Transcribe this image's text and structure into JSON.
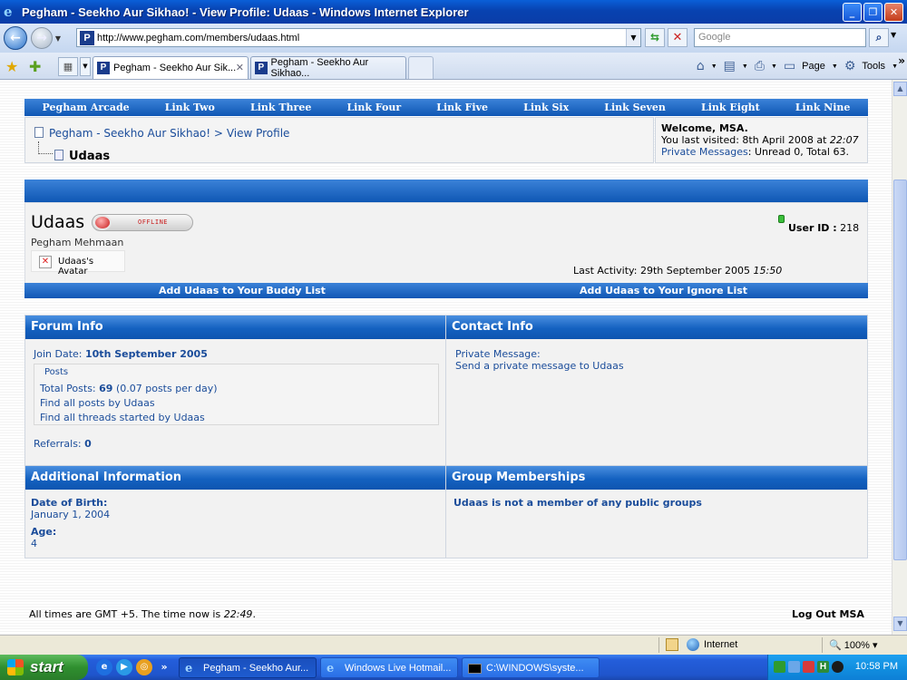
{
  "window": {
    "title": "Pegham - Seekho Aur Sikhao! - View Profile: Udaas - Windows Internet Explorer",
    "icon": "ie-icon"
  },
  "toolbar": {
    "url": "http://www.pegham.com/members/udaas.html",
    "search_placeholder": "Google",
    "page_label": "Page",
    "tools_label": "Tools"
  },
  "tabs": [
    {
      "label": "Pegham - Seekho Aur Sik...",
      "active": true
    },
    {
      "label": "Pegham - Seekho Aur Sikhao...",
      "active": false
    }
  ],
  "nav_links": [
    "Pegham Arcade",
    "Link Two",
    "Link Three",
    "Link Four",
    "Link Five",
    "Link Six",
    "Link Seven",
    "Link Eight",
    "Link Nine"
  ],
  "breadcrumb": {
    "home": "Pegham - Seekho Aur Sikhao!",
    "separator": ">",
    "section": "View Profile",
    "current": "Udaas"
  },
  "welcome": {
    "greeting": "Welcome, MSA.",
    "last_visited_prefix": "You last visited: 8th April 2008 at",
    "last_visited_time": "22:07",
    "pm_link": "Private Messages",
    "pm_counts": ": Unread 0, Total 63."
  },
  "profile": {
    "username": "Udaas",
    "status": "OFFLINE",
    "user_title": "Pegham Mehmaan",
    "avatar_alt": "Udaas's Avatar",
    "user_id_label": "User ID :",
    "user_id": "218",
    "last_activity_prefix": "Last Activity: 29th September 2005",
    "last_activity_time": "15:50"
  },
  "actions": {
    "add_buddy": "Add Udaas to Your Buddy List",
    "add_ignore": "Add Udaas to Your Ignore List"
  },
  "forum_info": {
    "heading": "Forum Info",
    "join_label": "Join Date:",
    "join_date": "10th September 2005",
    "posts_legend": "Posts",
    "total_posts_label": "Total Posts:",
    "total_posts": "69",
    "posts_per_day": "(0.07 posts per day)",
    "find_posts": "Find all posts by Udaas",
    "find_threads": "Find all threads started by Udaas",
    "referrals_label": "Referrals:",
    "referrals": "0"
  },
  "contact_info": {
    "heading": "Contact Info",
    "pm_label": "Private Message:",
    "pm_link": "Send a private message to Udaas"
  },
  "additional_info": {
    "heading": "Additional Information",
    "dob_label": "Date of Birth:",
    "dob": "January 1, 2004",
    "age_label": "Age:",
    "age": "4"
  },
  "group_memberships": {
    "heading": "Group Memberships",
    "text": "Udaas is not a member of any public groups"
  },
  "footer": {
    "time_prefix": "All times are GMT +5. The time now is",
    "time_now": "22:49",
    "time_suffix": ".",
    "logout": "Log Out MSA"
  },
  "statusbar": {
    "zone": "Internet",
    "zoom": "100%"
  },
  "taskbar": {
    "start": "start",
    "buttons": [
      "Pegham - Seekho Aur...",
      "Windows Live Hotmail...",
      "C:\\WINDOWS\\syste..."
    ],
    "clock": "10:58 PM"
  }
}
